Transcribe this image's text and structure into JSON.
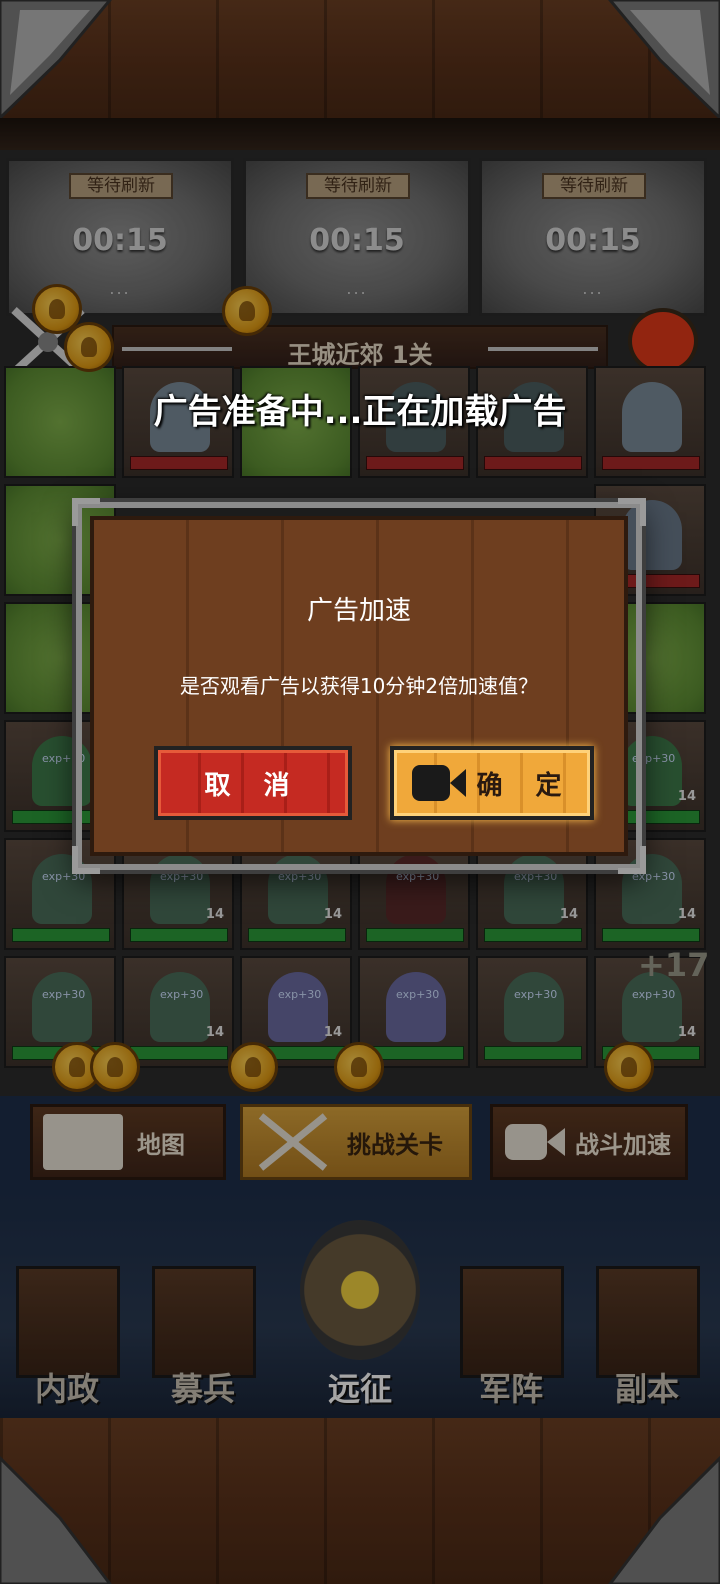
{
  "refresh_slots": [
    {
      "tag": "等待刷新",
      "time": "00:15",
      "dots": "..."
    },
    {
      "tag": "等待刷新",
      "time": "00:15",
      "dots": "..."
    },
    {
      "tag": "等待刷新",
      "time": "00:15",
      "dots": "..."
    }
  ],
  "stage": {
    "title": "王城近郊  1关"
  },
  "loading_text": "广告准备中...正在加载广告",
  "board": {
    "exp_label": "exp+30",
    "unit_level": "14",
    "bonus": "+17"
  },
  "dialog": {
    "title": "广告加速",
    "message": "是否观看广告以获得10分钟2倍加速值？",
    "cancel_label": "取 消",
    "confirm_label": "确 定"
  },
  "actions": {
    "map_label": "地图",
    "challenge_label": "挑战关卡",
    "speed_label": "战斗加速"
  },
  "nav": {
    "items": [
      {
        "label": "内政"
      },
      {
        "label": "募兵"
      },
      {
        "label": "远征"
      },
      {
        "label": "军阵"
      },
      {
        "label": "副本"
      }
    ]
  },
  "colors": {
    "accent": "#f0a83a",
    "cancel": "#c52a22",
    "grass": "#6e9e3e"
  }
}
